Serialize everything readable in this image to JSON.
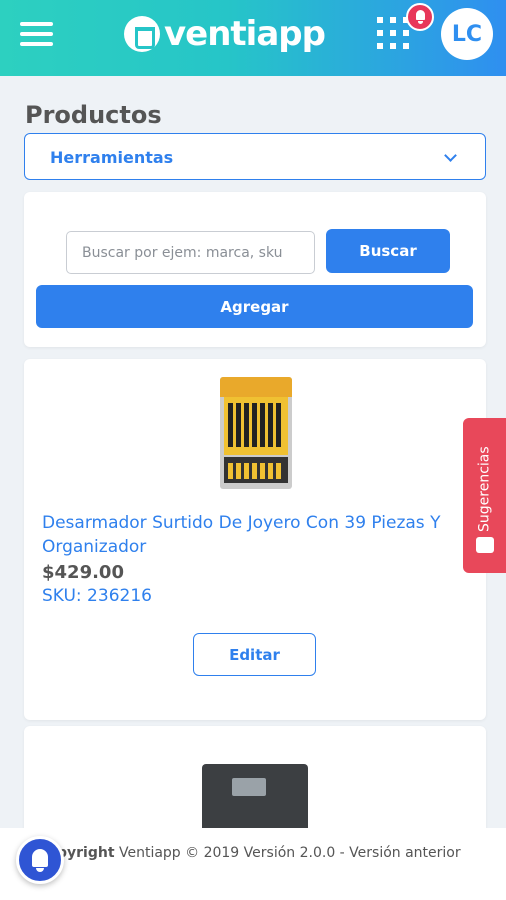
{
  "header": {
    "brand": "ventiapp",
    "avatar_initials": "LC",
    "menu_icon": "hamburger-icon",
    "apps_icon": "grid-icon",
    "notification_icon": "bell-icon"
  },
  "page": {
    "title": "Productos",
    "category_select": "Herramientas"
  },
  "search": {
    "placeholder": "Buscar por ejem: marca, sku",
    "search_button": "Buscar",
    "add_button": "Agregar"
  },
  "products": [
    {
      "name": "Desarmador Surtido De Joyero Con 39 Piezas Y Organizador",
      "price": "$429.00",
      "sku": "SKU: 236216",
      "edit_button": "Editar"
    }
  ],
  "suggestions_tab": {
    "label": "Sugerencias"
  },
  "footer": {
    "copyright_bold": "pyright",
    "copyright_rest": " Ventiapp © 2019 Versión 2.0.0 - Versión anterior"
  },
  "colors": {
    "accent": "#2f80ed",
    "header_start": "#2dd0c0",
    "header_end": "#2f8ff0",
    "suggestions": "#e8485a"
  }
}
